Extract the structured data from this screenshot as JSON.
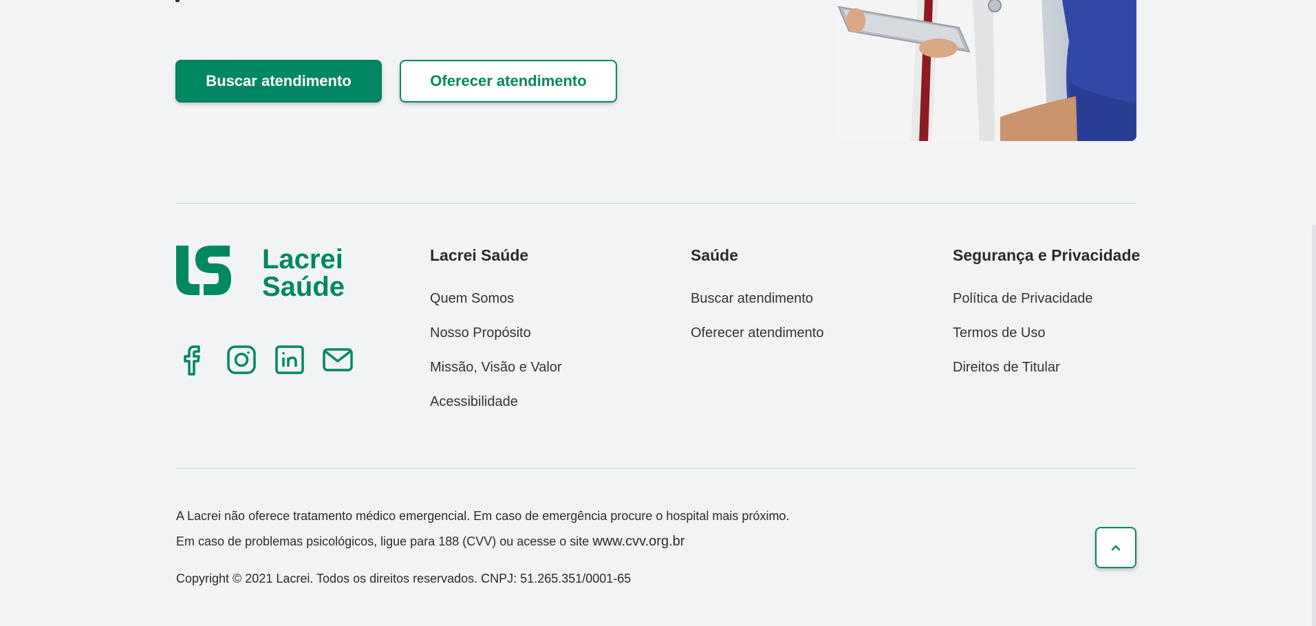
{
  "hero": {
    "primary_button": "Buscar atendimento",
    "secondary_button": "Oferecer atendimento"
  },
  "footer": {
    "brand": {
      "logo_line1": "Lacrei",
      "logo_line2": "Saúde"
    },
    "social": [
      "facebook-icon",
      "instagram-icon",
      "linkedin-icon",
      "mail-icon"
    ],
    "columns": [
      {
        "title": "Lacrei Saúde",
        "links": [
          "Quem Somos",
          "Nosso Propósito",
          "Missão, Visão e Valor",
          "Acessibilidade"
        ]
      },
      {
        "title": "Saúde",
        "links": [
          "Buscar atendimento",
          "Oferecer atendimento"
        ]
      },
      {
        "title": "Segurança e Privacidade",
        "links": [
          "Política de Privacidade",
          "Termos de Uso",
          "Direitos de Titular"
        ]
      }
    ],
    "legal": {
      "emergency": "A Lacrei não oferece tratamento médico emergencial. Em caso de emergência procure o hospital mais próximo.",
      "psych_prefix": "Em caso de problemas psicológicos, ligue para 188 (CVV) ou acesse o site",
      "psych_site": "www.cvv.org.br",
      "copyright": "Copyright © 2021 Lacrei. Todos os direitos reservados. CNPJ: 51.265.351/0001-65"
    }
  },
  "colors": {
    "brand_green": "#018762",
    "background": "#f2f3f5",
    "divider": "#b9dccf"
  }
}
